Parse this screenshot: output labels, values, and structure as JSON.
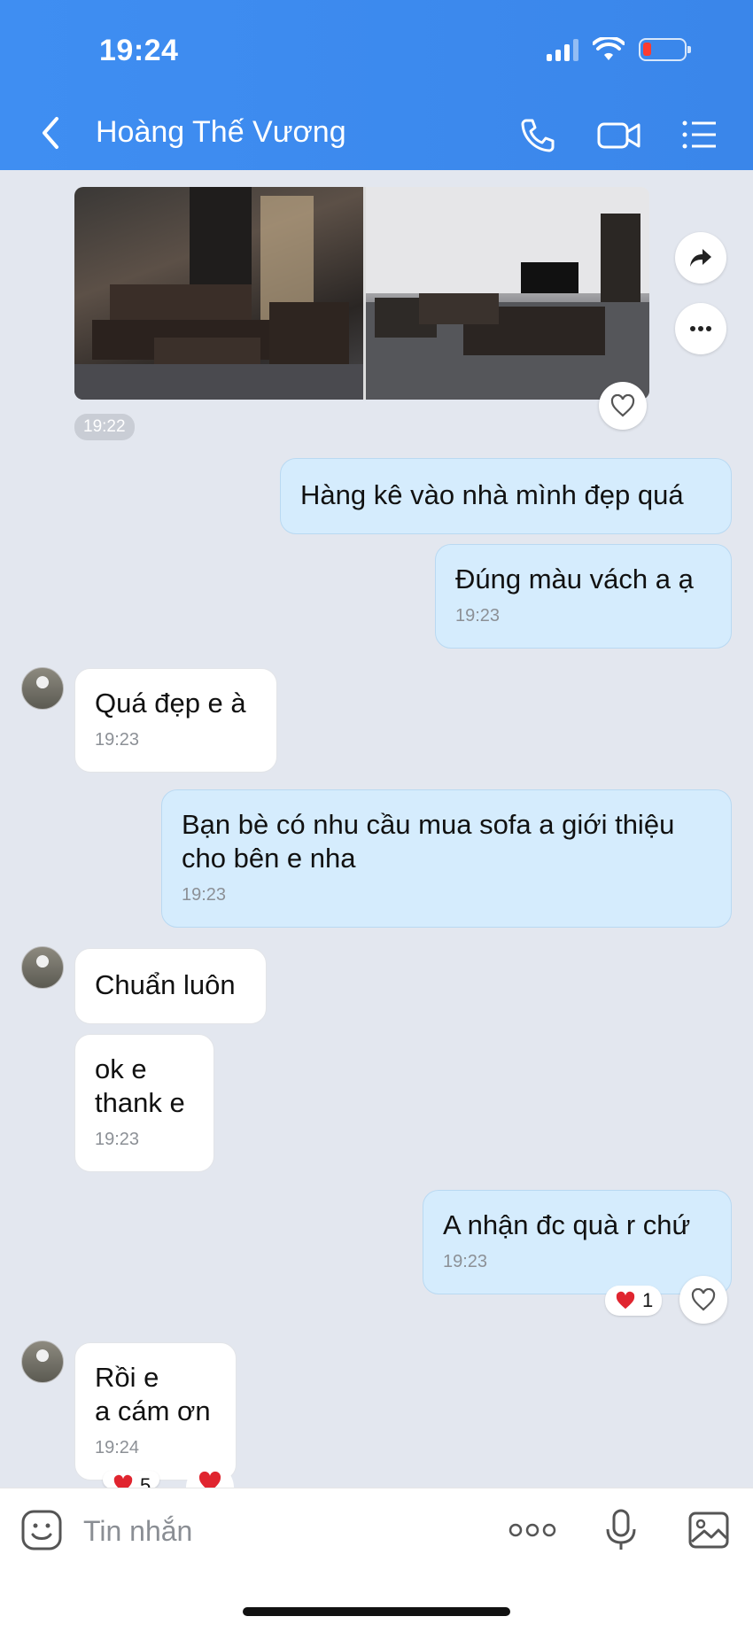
{
  "status_bar": {
    "time": "19:24"
  },
  "header": {
    "title": "Hoàng Thế Vương"
  },
  "messages": {
    "photo_time": "19:22",
    "m1_text": "Hàng kê vào nhà mình đẹp quá",
    "m2_text": "Đúng màu vách a ạ",
    "m2_time": "19:23",
    "m3_text": "Quá đẹp e à",
    "m3_time": "19:23",
    "m4_line1": "Bạn bè có nhu cầu mua sofa a giới thiệu",
    "m4_line2": "cho bên e nha",
    "m4_time": "19:23",
    "m5_text": "Chuẩn luôn",
    "m6_line1": "ok e",
    "m6_line2": "thank e",
    "m6_time": "19:23",
    "m7_text": "A nhận đc quà r chứ",
    "m7_time": "19:23",
    "m7_reaction_count": "1",
    "m8_line1": "Rồi e",
    "m8_line2": "a cám ơn",
    "m8_time": "19:24",
    "m8_reaction_count": "5"
  },
  "input": {
    "placeholder": "Tin nhắn"
  },
  "colors": {
    "header": "#3f8ef2",
    "outgoing_bubble": "#d5ecfd",
    "incoming_bubble": "#ffffff",
    "chat_bg": "#e3e7ef",
    "heart": "#e0252f"
  }
}
